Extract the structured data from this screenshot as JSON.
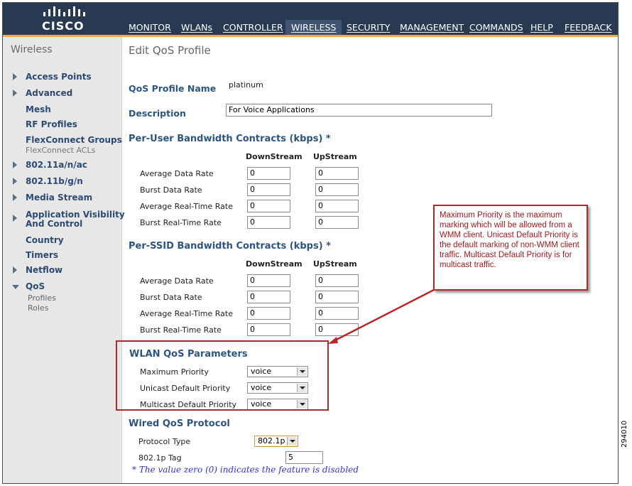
{
  "brand": {
    "logo_text": "CISCO"
  },
  "nav": [
    {
      "label": "MONITOR"
    },
    {
      "label": "WLANs"
    },
    {
      "label": "CONTROLLER"
    },
    {
      "label": "WIRELESS"
    },
    {
      "label": "SECURITY"
    },
    {
      "label": "MANAGEMENT"
    },
    {
      "label": "COMMANDS"
    },
    {
      "label": "HELP"
    },
    {
      "label": "FEEDBACK"
    }
  ],
  "sidebar": {
    "title": "Wireless",
    "items": [
      {
        "label": "Access Points"
      },
      {
        "label": "Advanced"
      },
      {
        "label": "Mesh"
      },
      {
        "label": "RF Profiles"
      },
      {
        "label": "FlexConnect Groups"
      },
      {
        "label": "FlexConnect ACLs"
      },
      {
        "label": "802.11a/n/ac"
      },
      {
        "label": "802.11b/g/n"
      },
      {
        "label": "Media Stream"
      },
      {
        "label": "Application Visibility"
      },
      {
        "label": "And Control"
      },
      {
        "label": "Country"
      },
      {
        "label": "Timers"
      },
      {
        "label": "Netflow"
      },
      {
        "label": "QoS"
      },
      {
        "label": "Profiles"
      },
      {
        "label": "Roles"
      }
    ]
  },
  "page": {
    "title": "Edit QoS Profile",
    "profile_name_label": "QoS Profile Name",
    "profile_name_value": "platinum",
    "description_label": "Description",
    "description_value": "For Voice Applications"
  },
  "per_user": {
    "title": "Per-User Bandwidth Contracts (kbps) *",
    "col_down": "DownStream",
    "col_up": "UpStream",
    "rows": [
      {
        "label": "Average Data Rate",
        "down": "0",
        "up": "0"
      },
      {
        "label": "Burst Data Rate",
        "down": "0",
        "up": "0"
      },
      {
        "label": "Average Real-Time Rate",
        "down": "0",
        "up": "0"
      },
      {
        "label": "Burst Real-Time Rate",
        "down": "0",
        "up": "0"
      }
    ]
  },
  "per_ssid": {
    "title": "Per-SSID Bandwidth Contracts (kbps) *",
    "col_down": "DownStream",
    "col_up": "UpStream",
    "rows": [
      {
        "label": "Average Data Rate",
        "down": "0",
        "up": "0"
      },
      {
        "label": "Burst Data Rate",
        "down": "0",
        "up": "0"
      },
      {
        "label": "Average Real-Time Rate",
        "down": "0",
        "up": "0"
      },
      {
        "label": "Burst Real-Time Rate",
        "down": "0",
        "up": "0"
      }
    ]
  },
  "wlan_qos": {
    "title": "WLAN QoS Parameters",
    "rows": [
      {
        "label": "Maximum Priority",
        "value": "voice"
      },
      {
        "label": "Unicast Default Priority",
        "value": "voice"
      },
      {
        "label": "Multicast Default Priority",
        "value": "voice"
      }
    ]
  },
  "wired_qos": {
    "title": "Wired QoS Protocol",
    "protocol_label": "Protocol Type",
    "protocol_value": "802.1p",
    "tag_label": "802.1p Tag",
    "tag_value": "5"
  },
  "footnote": "* The value zero (0) indicates the feature is disabled",
  "callout": "Maximum Priority is the maximum marking which will be allowed from a WMM client.  Unicast Default  Priority is the default marking of non-WMM client traffic. Multicast Default  Priority is for multicast traffic.",
  "figure_number": "294010",
  "colors": {
    "header_bg": "#283a52",
    "accent": "#f0a94a",
    "highlight_red": "#b8262b",
    "label_blue": "#2c5580"
  }
}
